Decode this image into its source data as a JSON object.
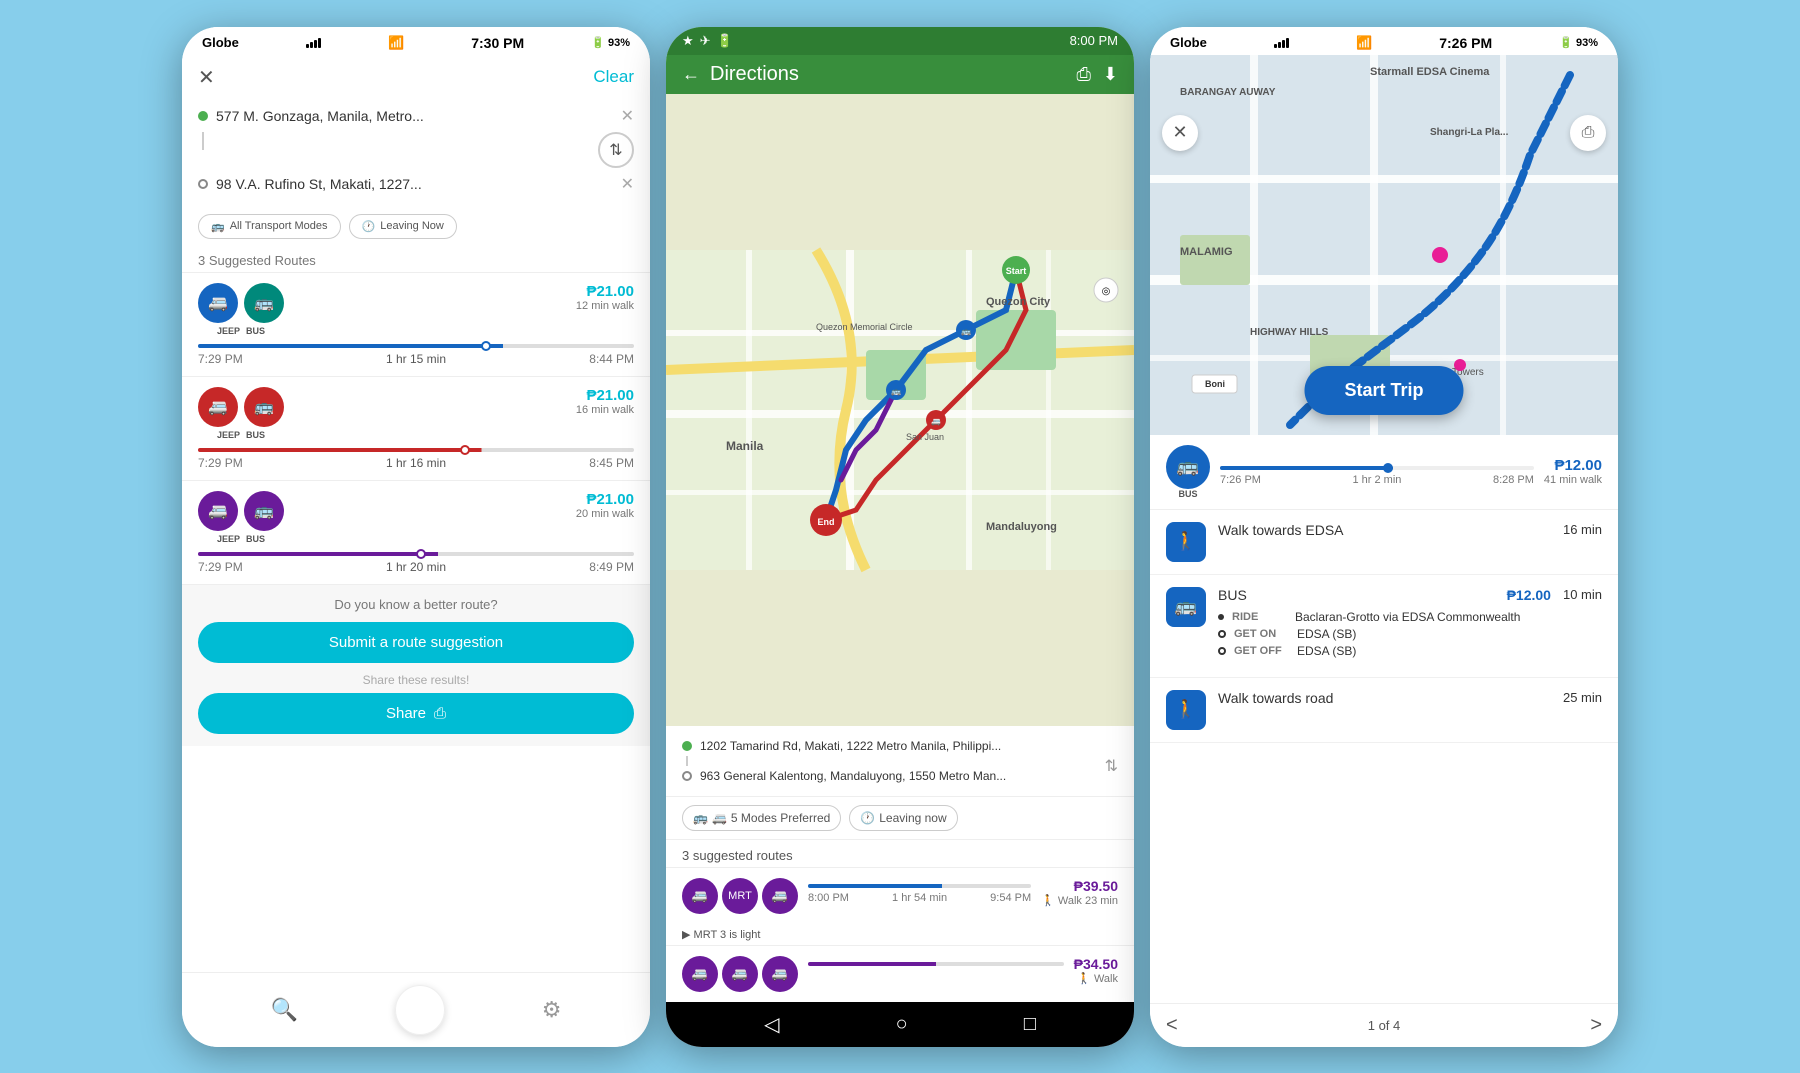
{
  "phone1": {
    "status": {
      "carrier": "Globe",
      "time": "7:30 PM",
      "battery": "93%"
    },
    "header": {
      "clear_label": "Clear"
    },
    "origin": "577 M. Gonzaga, Manila, Metro...",
    "destination": "98 V.A. Rufino St, Makati, 1227...",
    "filters": {
      "transport_label": "All Transport Modes",
      "time_label": "Leaving Now"
    },
    "suggested_label": "3 Suggested Routes",
    "routes": [
      {
        "mode1": "JEEP",
        "mode2": "BUS",
        "color": "blue",
        "price": "₱21.00",
        "walk": "12 min walk",
        "depart": "7:29 PM",
        "duration": "1 hr 15 min",
        "arrive": "8:44 PM",
        "bar_color": "#1565C0",
        "dot_pos": "60%"
      },
      {
        "mode1": "JEEP",
        "mode2": "BUS",
        "color": "red",
        "price": "₱21.00",
        "walk": "16 min walk",
        "depart": "7:29 PM",
        "duration": "1 hr 16 min",
        "arrive": "8:45 PM",
        "bar_color": "#C62828",
        "dot_pos": "55%"
      },
      {
        "mode1": "JEEP",
        "mode2": "BUS",
        "color": "purple",
        "price": "₱21.00",
        "walk": "20 min walk",
        "depart": "7:29 PM",
        "duration": "1 hr 20 min",
        "arrive": "8:49 PM",
        "bar_color": "#6A1B9A",
        "dot_pos": "50%"
      }
    ],
    "bottom": {
      "better_route": "Do you know a better route?",
      "submit_label": "Submit a route suggestion",
      "share_hint": "Share these results!",
      "share_label": "Share"
    },
    "nav": {
      "search": "🔍",
      "home": "●",
      "settings": "⚙"
    }
  },
  "phone2": {
    "status": {
      "time": "8:00 PM",
      "battery": "●"
    },
    "header": {
      "back_label": "←",
      "title": "Directions"
    },
    "origin": "1202 Tamarind Rd, Makati, 1222 Metro Manila, Philippi...",
    "destination": "963 General Kalentong, Mandaluyong, 1550 Metro Man...",
    "filters": {
      "modes_label": "5 Modes Preferred",
      "time_label": "Leaving now"
    },
    "suggested_label": "3 suggested routes",
    "routes": [
      {
        "mode1": "JEEP",
        "mode2": "MRT3",
        "mode3": "JEEP",
        "price": "₱39.50",
        "walk": "Walk 23 min",
        "depart": "8:00 PM",
        "duration": "1 hr 54 min",
        "arrive": "9:54 PM",
        "mrt_note": "MRT 3 is light",
        "bar_color": "#1565C0"
      },
      {
        "price": "₱34.50",
        "walk": "Walk",
        "bar_color": "#1565C0"
      }
    ],
    "android_nav": {
      "back": "◁",
      "home": "○",
      "recent": "□"
    }
  },
  "phone3": {
    "status": {
      "carrier": "Globe",
      "time": "7:26 PM",
      "battery": "93%"
    },
    "map": {
      "start_trip_label": "Start Trip"
    },
    "route": {
      "transport": "BUS",
      "price": "₱12.00",
      "walk": "41 min walk",
      "depart": "7:26 PM",
      "duration": "1 hr 2 min",
      "arrive": "8:28 PM"
    },
    "steps": [
      {
        "type": "walk",
        "title": "Walk towards EDSA",
        "duration": "16 min"
      },
      {
        "type": "bus",
        "title": "BUS",
        "price": "₱12.00",
        "duration": "10 min",
        "ride_label": "RIDE",
        "ride_value": "Baclaran-Grotto via EDSA Commonwealth",
        "get_on_label": "GET ON",
        "get_on_value": "EDSA (SB)",
        "get_off_label": "GET OFF",
        "get_off_value": "EDSA (SB)"
      },
      {
        "type": "walk",
        "title": "Walk towards road",
        "duration": "25 min"
      }
    ],
    "pagination": {
      "prev": "<",
      "next": ">",
      "info": "1 of 4"
    }
  }
}
